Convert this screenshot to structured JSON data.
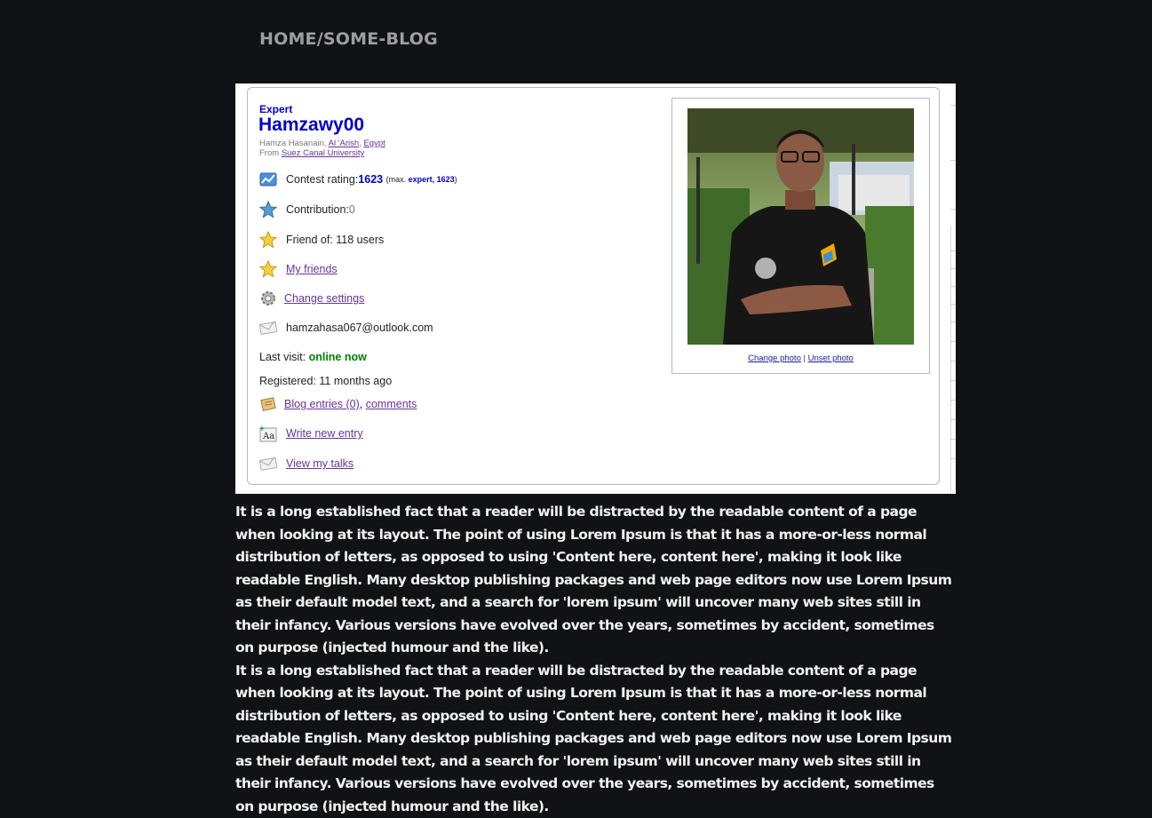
{
  "breadcrumb": "HOME/SOME-BLOG",
  "profile": {
    "rank": "Expert",
    "handle": "Hamzawy00",
    "name_prefix": "Hamza Hasanain, ",
    "city": "Al 'Arish",
    "country": "Egypt",
    "from_label": "From ",
    "organization": "Suez Canal University",
    "rating_label": "Contest rating: ",
    "rating_value": "1623",
    "rating_max_prefix": "(max. ",
    "rating_max_rank": "expert, 1623",
    "rating_max_suffix": ")",
    "contribution_label": "Contribution: ",
    "contribution_value": "0",
    "friend_of": "Friend of: 118 users",
    "my_friends": "My friends",
    "change_settings": "Change settings",
    "email": "hamzahasa067@outlook.com",
    "last_visit_label": "Last visit: ",
    "last_visit_value": "online now",
    "registered": "Registered: 11 months ago",
    "blog_entries": "Blog entries (0)",
    "comments": "comments",
    "write_new_entry": "Write new entry",
    "view_my_talks": "View my talks",
    "change_photo": "Change photo",
    "unset_photo": "Unset photo",
    "photo_separator": " | "
  },
  "colors": {
    "background": "#111216",
    "rank_blue": "#0000cc",
    "link_purple": "#663399",
    "online_green": "#008000"
  },
  "icons": [
    "rating-chart-icon",
    "blue-star-icon",
    "gold-star-icon",
    "gold-star-icon",
    "gear-icon",
    "envelope-icon",
    "scroll-icon",
    "write-aa-icon",
    "envelope-icon"
  ],
  "article": {
    "paragraph_1": "It is a long established fact that a reader will be distracted by the readable content of a page when looking at its layout. The point of using Lorem Ipsum is that it has a more-or-less normal distribution of letters, as opposed to using 'Content here, content here', making it look like readable English. Many desktop publishing packages and web page editors now use Lorem Ipsum as their default model text, and a search for 'lorem ipsum' will uncover many web sites still in their infancy. Various versions have evolved over the years, sometimes by accident, sometimes on purpose (injected humour and the like).",
    "paragraph_2": "It is a long established fact that a reader will be distracted by the readable content of a page when looking at its layout. The point of using Lorem Ipsum is that it has a more-or-less normal distribution of letters, as opposed to using 'Content here, content here', making it look like readable English. Many desktop publishing packages and web page editors now use Lorem Ipsum as their default model text, and a search for 'lorem ipsum' will uncover many web sites still in their infancy. Various versions have evolved over the years, sometimes by accident, sometimes on purpose (injected humour and the like)."
  }
}
